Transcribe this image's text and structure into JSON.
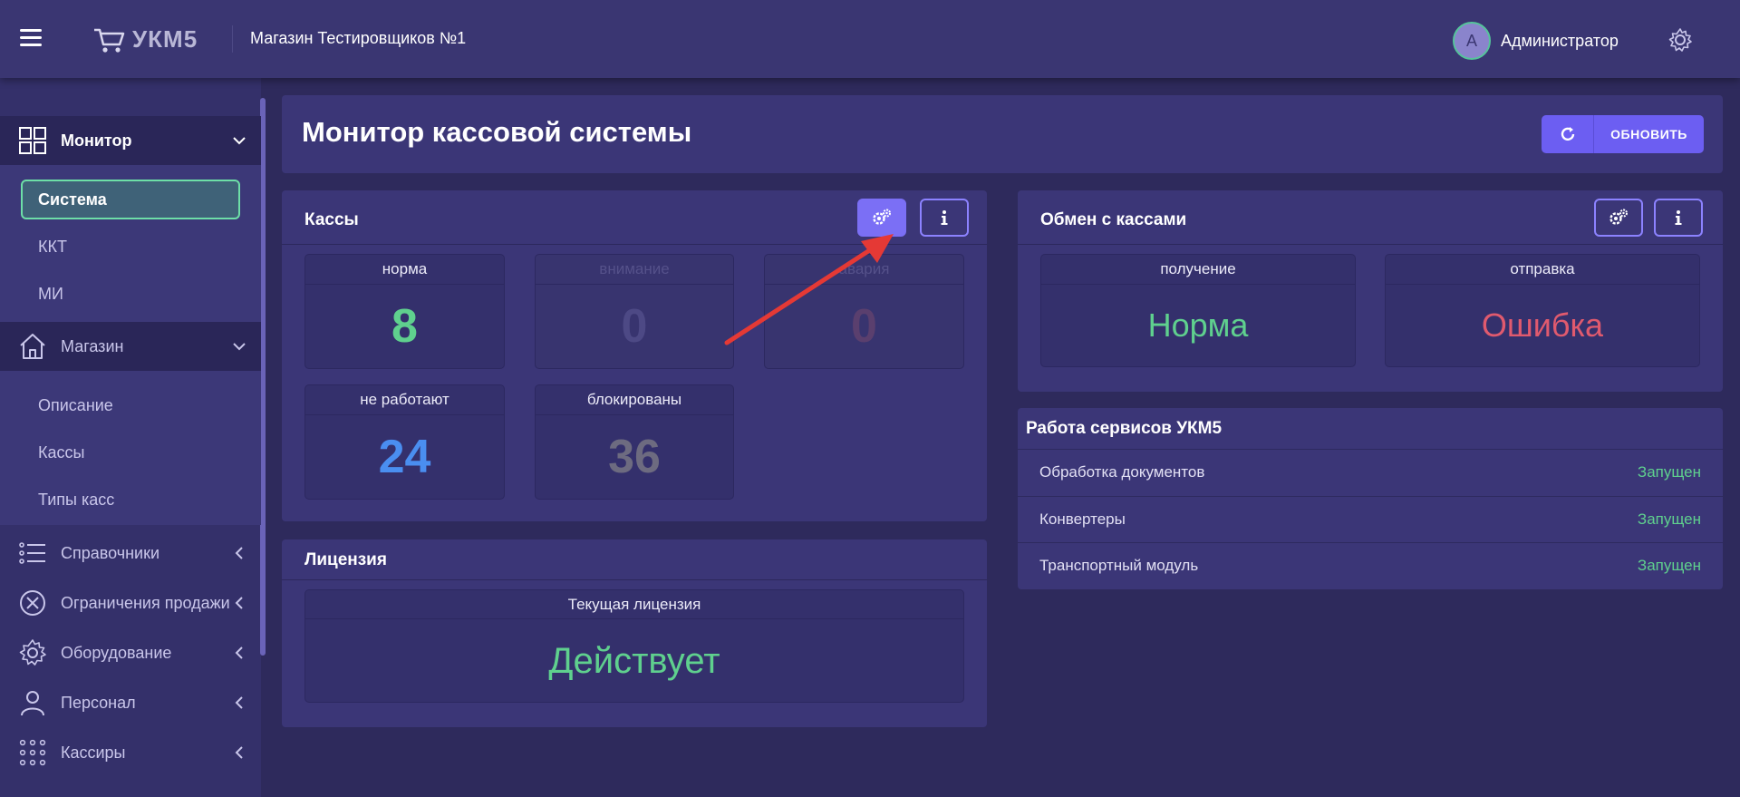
{
  "header": {
    "logo_text": "УКМ5",
    "shop_name": "Магазин Тестировщиков №1",
    "avatar_letter": "A",
    "username": "Администратор"
  },
  "sidebar": {
    "groups": [
      {
        "label": "Монитор",
        "icon": "monitor-grid-icon",
        "state": "open",
        "items": [
          "Система",
          "ККТ",
          "МИ"
        ],
        "active_item": "Система"
      },
      {
        "label": "Магазин",
        "icon": "store-icon",
        "state": "open",
        "items": [
          "Описание",
          "Кассы",
          "Типы касс"
        ]
      },
      {
        "label": "Справочники",
        "icon": "list-icon",
        "state": "collapsed"
      },
      {
        "label": "Ограничения продажи",
        "icon": "restriction-icon",
        "state": "collapsed"
      },
      {
        "label": "Оборудование",
        "icon": "gear-icon",
        "state": "collapsed"
      },
      {
        "label": "Персонал",
        "icon": "person-icon",
        "state": "collapsed"
      },
      {
        "label": "Кассиры",
        "icon": "dots-grid-icon",
        "state": "collapsed"
      }
    ]
  },
  "page": {
    "title": "Монитор кассовой системы",
    "refresh_label": "ОБНОВИТЬ"
  },
  "kassy": {
    "title": "Кассы",
    "stats": [
      {
        "label": "норма",
        "value": "8",
        "color": "#5fd08e"
      },
      {
        "label": "внимание",
        "value": "0",
        "color": "#4d4985"
      },
      {
        "label": "авария",
        "value": "0",
        "color": "#5a3f6e"
      },
      {
        "label": "не работают",
        "value": "24",
        "color": "#4a8ef0"
      },
      {
        "label": "блокированы",
        "value": "36",
        "color": "#6d6b80"
      }
    ]
  },
  "license": {
    "title": "Лицензия",
    "label": "Текущая лицензия",
    "value": "Действует",
    "color": "#5fd08e"
  },
  "exchange": {
    "title": "Обмен с кассами",
    "receive_label": "получение",
    "receive_value": "Норма",
    "receive_color": "#5fd08e",
    "send_label": "отправка",
    "send_value": "Ошибка",
    "send_color": "#e05a6e"
  },
  "services": {
    "title": "Работа сервисов УКМ5",
    "rows": [
      {
        "name": "Обработка документов",
        "status": "Запущен"
      },
      {
        "name": "Конвертеры",
        "status": "Запущен"
      },
      {
        "name": "Транспортный модуль",
        "status": "Запущен"
      }
    ]
  },
  "colors": {
    "accent": "#6c5ef2",
    "ok": "#5fd08e",
    "error": "#e05a6e",
    "annotation_arrow": "#e53935"
  }
}
